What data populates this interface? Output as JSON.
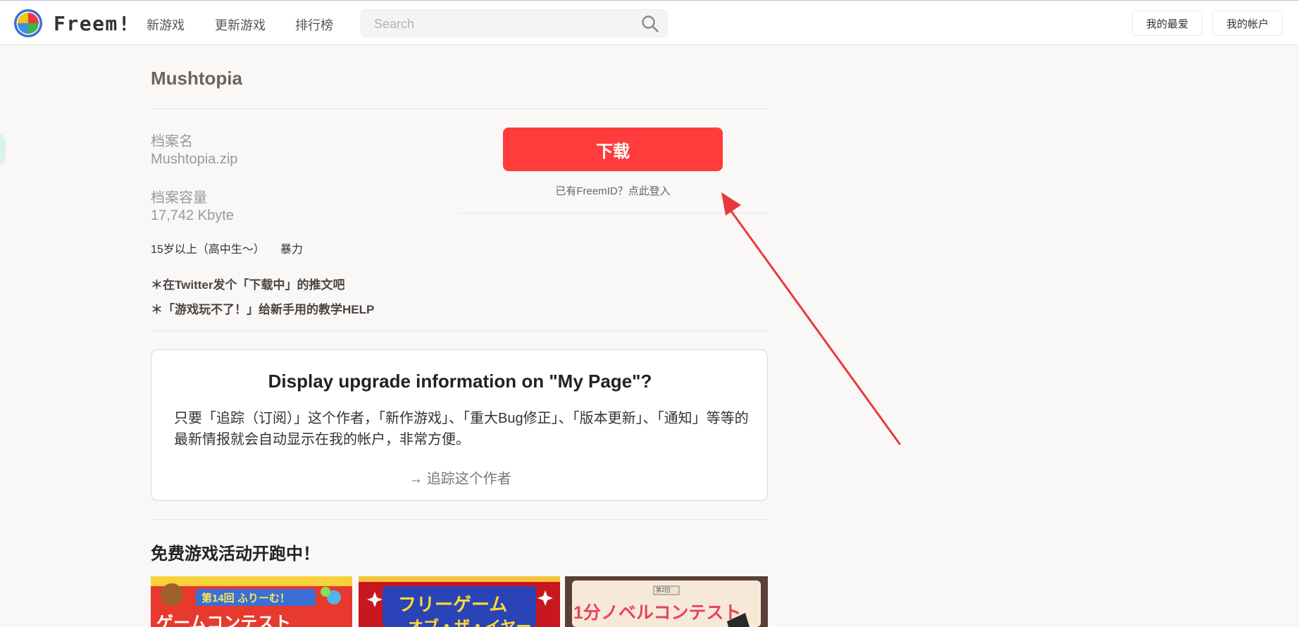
{
  "header": {
    "logo_text": "Freem!",
    "nav": [
      "新游戏",
      "更新游戏",
      "排行榜"
    ],
    "search_placeholder": "Search",
    "favorites_label": "我的最爱",
    "account_label": "我的帐户"
  },
  "game": {
    "title": "Mushtopia",
    "file_name_label": "档案名",
    "file_name": "Mushtopia.zip",
    "file_size_label": "档案容量",
    "file_size": "17,742 Kbyte",
    "age_rating": "15岁以上（高中生〜）",
    "content_tag": "暴力",
    "twitter_link": "＊在Twitter发个「下载中」的推文吧",
    "help_link": "＊「游戏玩不了！」给新手用的教学HELP"
  },
  "download": {
    "button_label": "下载",
    "login_link": "已有FreemID？点此登入"
  },
  "upgrade": {
    "title": "Display upgrade information on \"My Page\"?",
    "body": "只要「追踪（订阅）」这个作者，「新作游戏」、「重大Bug修正」、「版本更新」、「通知」等等的最新情报就会自动显示在我的帐户，非常方便。",
    "follow_link": "→ 追踪这个作者"
  },
  "campaign": {
    "title": "免费游戏活动开跑中！",
    "banners": [
      {
        "headline": "第14回 ふりーむ！",
        "sub": "ゲームコンテスト"
      },
      {
        "headline": "フリーゲーム",
        "sub": "オブ・ザ・イヤー"
      },
      {
        "headline": "1分ノベルコンテスト",
        "badge": "第2回"
      }
    ]
  }
}
